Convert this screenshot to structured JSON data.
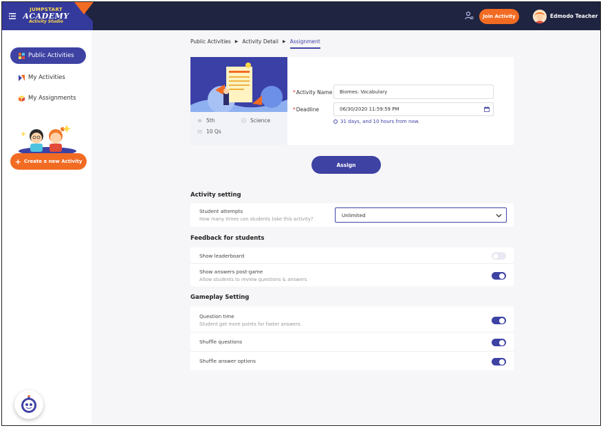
{
  "brand": {
    "line1": "JUMPSTART",
    "line2": "ACADEMY",
    "line3": "Activity Studio",
    "primary_color": "#3e42a3",
    "accent_color": "#f26b22",
    "topbar_color": "#1f2440"
  },
  "header": {
    "join_label": "Join Activity",
    "user_name": "Edmodo Teacher"
  },
  "sidebar": {
    "items": [
      {
        "label": "Public Activities",
        "active": true,
        "icon": "grid-icon"
      },
      {
        "label": "My Activities",
        "active": false,
        "icon": "flag-icon"
      },
      {
        "label": "My Assignments",
        "active": false,
        "icon": "box-icon"
      }
    ],
    "create_label": "Create a new Activity"
  },
  "breadcrumb": [
    "Public Activities",
    "Activity Detail",
    "Assignment"
  ],
  "activity": {
    "grade": "5th",
    "subject": "Science",
    "questions": "10 Qs",
    "name_label": "Activity Name",
    "name_value": "Biomes: Vocabulary",
    "deadline_label": "Deadline",
    "deadline_value": "06/30/2020 11:59:59 PM",
    "due_note": "31 days, and 10 hours from now."
  },
  "assign_label": "Assign",
  "activity_setting": {
    "title": "Activity setting",
    "attempts_title": "Student attempts",
    "attempts_sub": "How many times can students take this activity?",
    "attempts_value": "Unlimited"
  },
  "feedback": {
    "title": "Feedback for students",
    "rows": [
      {
        "title": "Show leaderboard",
        "sub": "",
        "on": false
      },
      {
        "title": "Show answers post-game",
        "sub": "Allow students to review questions & answers",
        "on": true
      }
    ]
  },
  "gameplay": {
    "title": "Gameplay Setting",
    "rows": [
      {
        "title": "Question time",
        "sub": "Student get more points for faster answers.",
        "on": true
      },
      {
        "title": "Shuffle questions",
        "sub": "",
        "on": true
      },
      {
        "title": "Shuffle answer options",
        "sub": "",
        "on": true
      }
    ]
  }
}
